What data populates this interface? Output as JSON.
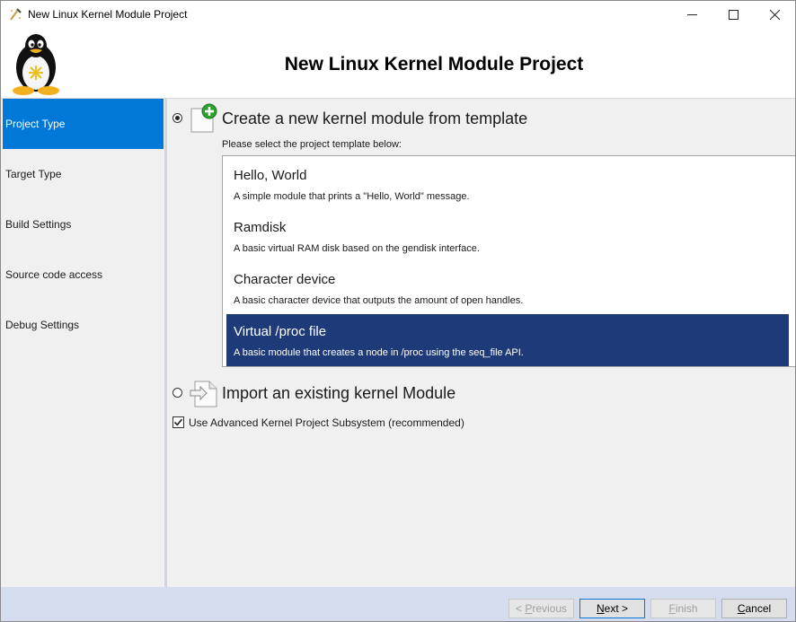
{
  "window": {
    "title": "New Linux Kernel Module Project",
    "controls": {
      "minimize": "—",
      "maximize": "☐",
      "close": "✕"
    }
  },
  "header": {
    "title": "New Linux Kernel Module Project",
    "logo_icon": "tux-penguin-icon"
  },
  "sidebar": {
    "active_index": 0,
    "items": [
      {
        "label": "Project Type"
      },
      {
        "label": "Target Type"
      },
      {
        "label": "Build Settings"
      },
      {
        "label": "Source code access"
      },
      {
        "label": "Debug Settings"
      }
    ]
  },
  "content": {
    "option_new": {
      "label": "Create a new kernel module from template",
      "selected": true,
      "icon": "new-document-plus-icon"
    },
    "template_prompt": "Please select the project template below:",
    "templates": [
      {
        "title": "Hello, World",
        "description": "A simple module that prints a \"Hello, World\" message."
      },
      {
        "title": "Ramdisk",
        "description": "A basic virtual RAM disk based on the gendisk interface."
      },
      {
        "title": "Character device",
        "description": "A basic character device that outputs the amount of open handles."
      },
      {
        "title": "Virtual /proc file",
        "description": "A basic module that creates a node in /proc using the seq_file API."
      }
    ],
    "selected_template_index": 3,
    "option_import": {
      "label": "Import an existing kernel Module",
      "selected": false,
      "icon": "import-document-icon"
    },
    "advanced_subsystem": {
      "label": "Use Advanced Kernel Project Subsystem (recommended)",
      "checked": true
    }
  },
  "footer": {
    "previous": {
      "prefix": "< ",
      "accel": "P",
      "rest": "revious"
    },
    "next": {
      "accel": "N",
      "rest": "ext >"
    },
    "finish": {
      "accel": "F",
      "rest": "inish"
    },
    "cancel": {
      "accel": "C",
      "rest": "ancel"
    }
  },
  "colors": {
    "accent": "#0078d7",
    "selected_template": "#1e3a78",
    "footer_bg": "#d4dced"
  }
}
